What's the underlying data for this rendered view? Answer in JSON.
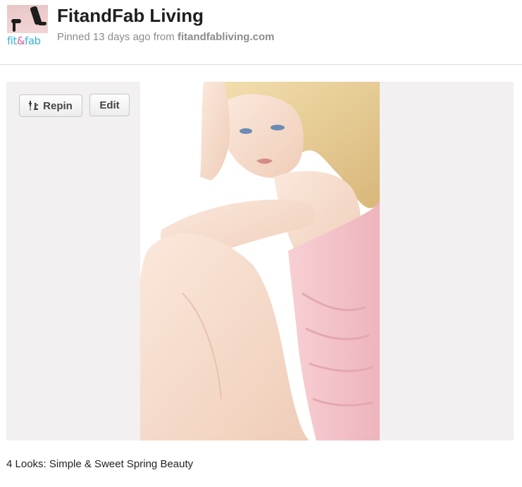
{
  "pin": {
    "title": "FitandFab Living",
    "pinned_prefix": "Pinned 13 days ago from ",
    "source": "fitandfabliving.com",
    "avatar_logo_text": "fit&fab",
    "avatar_logo_part1": "fit",
    "avatar_logo_amp": "&",
    "avatar_logo_part2": "fab"
  },
  "actions": {
    "repin_label": "Repin",
    "edit_label": "Edit"
  },
  "caption": "4 Looks: Simple & Sweet Spring Beauty",
  "colors": {
    "pin_area_bg": "#f2f0f0",
    "title": "#1e1e1e",
    "meta": "#8c8c8c",
    "logo_blue": "#37b3d8",
    "logo_pink": "#e35b9a",
    "dress_pink": "#f3c3c9",
    "hair_blonde": "#ecd39a",
    "skin": "#f6dccb"
  },
  "icons": {
    "avatar": "fitandfab-avatar-photo",
    "repin": "repin-icon"
  }
}
